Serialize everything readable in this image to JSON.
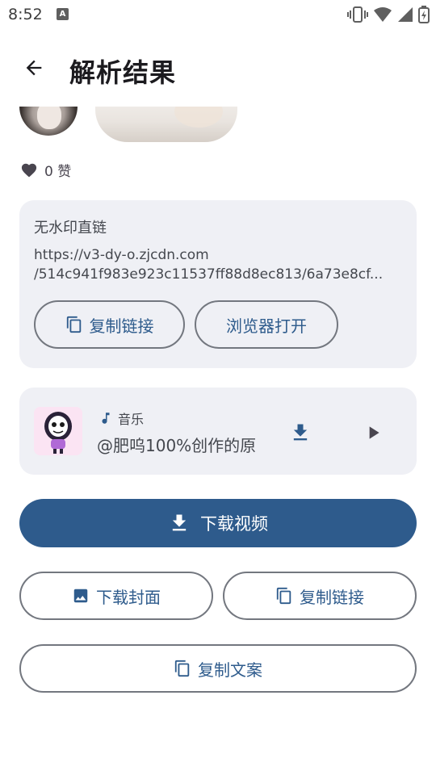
{
  "status_bar": {
    "time": "8:52",
    "notification_icon_letter": "A"
  },
  "app_bar": {
    "title": "解析结果"
  },
  "likes": {
    "count_text": "0 赞"
  },
  "link_card": {
    "title": "无水印直链",
    "url_line1": "https://v3-dy-o.zjcdn.com",
    "url_line2": "/514c941f983e923c11537ff88d8ec813/6a73e8cf...",
    "copy_link_label": "复制链接",
    "open_browser_label": "浏览器打开"
  },
  "music_card": {
    "label": "音乐",
    "title": "@肥呜100%创作的原"
  },
  "actions": {
    "download_video_label": "下载视频",
    "download_cover_label": "下载封面",
    "copy_link_label": "复制链接",
    "copy_text_label": "复制文案"
  },
  "colors": {
    "primary": "#2e5b8c",
    "card_bg": "#eff0f5",
    "outline": "#73777f"
  }
}
